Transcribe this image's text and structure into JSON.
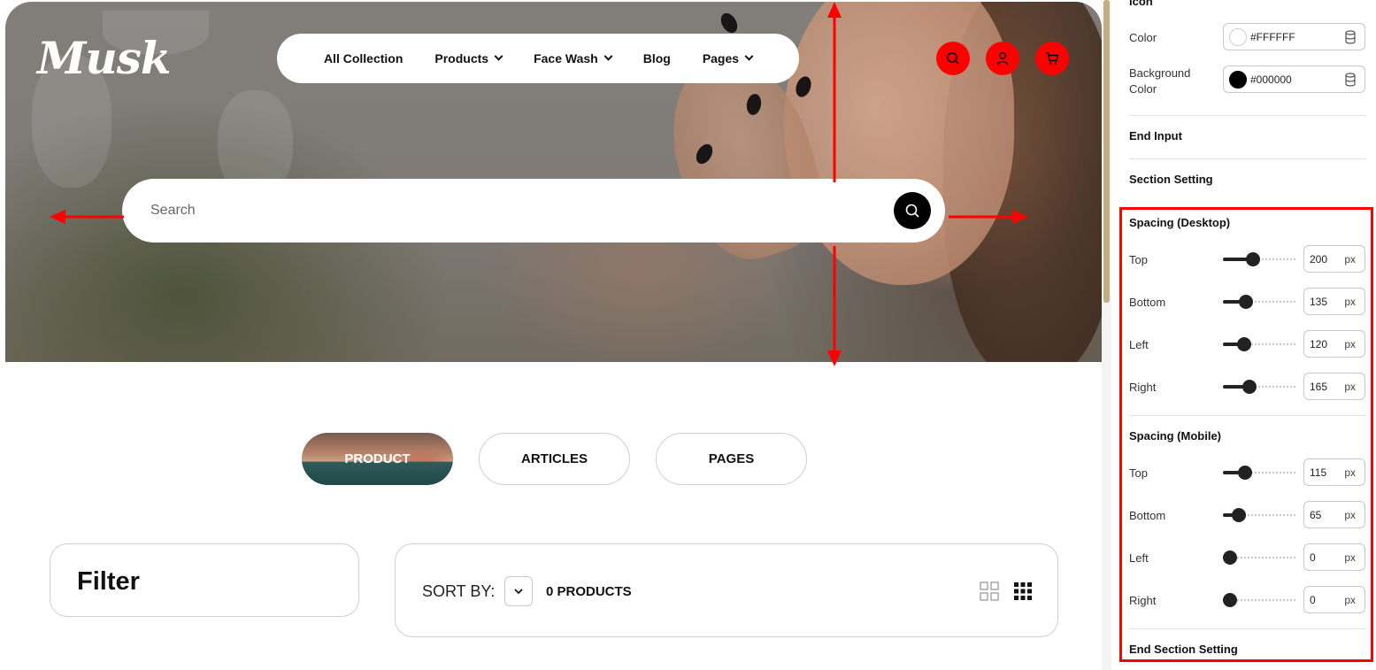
{
  "brand": {
    "logo": "Musk"
  },
  "nav": {
    "items": [
      {
        "label": "All Collection",
        "dropdown": false
      },
      {
        "label": "Products",
        "dropdown": true
      },
      {
        "label": "Face Wash",
        "dropdown": true
      },
      {
        "label": "Blog",
        "dropdown": false
      },
      {
        "label": "Pages",
        "dropdown": true
      }
    ]
  },
  "header_icons": [
    "search-icon",
    "user-icon",
    "cart-icon"
  ],
  "search": {
    "placeholder": "Search"
  },
  "tabs": [
    "PRODUCT",
    "ARTICLES",
    "PAGES"
  ],
  "active_tab": "PRODUCT",
  "filter": {
    "title": "Filter"
  },
  "sort": {
    "label": "SORT BY:",
    "count": "0 PRODUCTS"
  },
  "panel": {
    "icon_section": {
      "title": "Icon",
      "color_label": "Color",
      "color_value": "#FFFFFF",
      "bg_label_1": "Background",
      "bg_label_2": "Color",
      "bg_value": "#000000"
    },
    "end_input": "End Input",
    "section_setting": "Section Setting",
    "spacing_desktop": {
      "title": "Spacing (Desktop)",
      "rows": [
        {
          "label": "Top",
          "value": "200",
          "unit": "px",
          "level": 0.4
        },
        {
          "label": "Bottom",
          "value": "135",
          "unit": "px",
          "level": 0.27
        },
        {
          "label": "Left",
          "value": "120",
          "unit": "px",
          "level": 0.24
        },
        {
          "label": "Right",
          "value": "165",
          "unit": "px",
          "level": 0.33
        }
      ]
    },
    "spacing_mobile": {
      "title": "Spacing (Mobile)",
      "rows": [
        {
          "label": "Top",
          "value": "115",
          "unit": "px",
          "level": 0.26
        },
        {
          "label": "Bottom",
          "value": "65",
          "unit": "px",
          "level": 0.15
        },
        {
          "label": "Left",
          "value": "0",
          "unit": "px",
          "level": 0
        },
        {
          "label": "Right",
          "value": "0",
          "unit": "px",
          "level": 0
        }
      ]
    },
    "end_section": "End Section Setting"
  },
  "colors": {
    "accent": "#ff0000",
    "highlight": "#ff0000",
    "scroll_thumb": "#c3ad86"
  }
}
